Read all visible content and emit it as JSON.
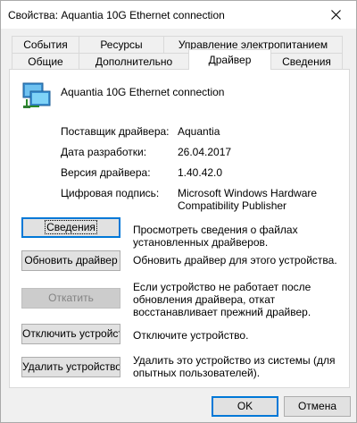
{
  "window": {
    "title": "Свойства: Aquantia 10G Ethernet connection"
  },
  "tabs_row1": [
    {
      "label": "События"
    },
    {
      "label": "Ресурсы"
    },
    {
      "label": "Управление электропитанием"
    }
  ],
  "tabs_row2": [
    {
      "label": "Общие"
    },
    {
      "label": "Дополнительно"
    },
    {
      "label": "Драйвер",
      "active": true
    },
    {
      "label": "Сведения"
    }
  ],
  "device": {
    "name": "Aquantia 10G Ethernet connection",
    "icon": "network-adapter-icon"
  },
  "info": [
    {
      "label": "Поставщик драйвера:",
      "value": "Aquantia"
    },
    {
      "label": "Дата разработки:",
      "value": "26.04.2017"
    },
    {
      "label": "Версия драйвера:",
      "value": "1.40.42.0"
    },
    {
      "label": "Цифровая подпись:",
      "value": "Microsoft Windows Hardware Compatibility Publisher"
    }
  ],
  "actions": [
    {
      "label": "Сведения",
      "description": "Просмотреть сведения о файлах установленных драйверов.",
      "enabled": true
    },
    {
      "label": "Обновить драйвер",
      "description": "Обновить драйвер для этого устройства.",
      "enabled": true
    },
    {
      "label": "Откатить",
      "description": "Если устройство не работает после обновления драйвера, откат восстанавливает прежний драйвер.",
      "enabled": false
    },
    {
      "label": "Отключить устройство",
      "description": "Отключите устройство.",
      "enabled": true
    },
    {
      "label": "Удалить устройство",
      "description": "Удалить это устройство из системы (для опытных пользователей).",
      "enabled": true
    }
  ],
  "footer": {
    "ok_label": "OK",
    "cancel_label": "Отмена"
  },
  "colors": {
    "accent": "#0078d7",
    "button_face": "#e1e1e1",
    "disabled_text": "#838383"
  }
}
